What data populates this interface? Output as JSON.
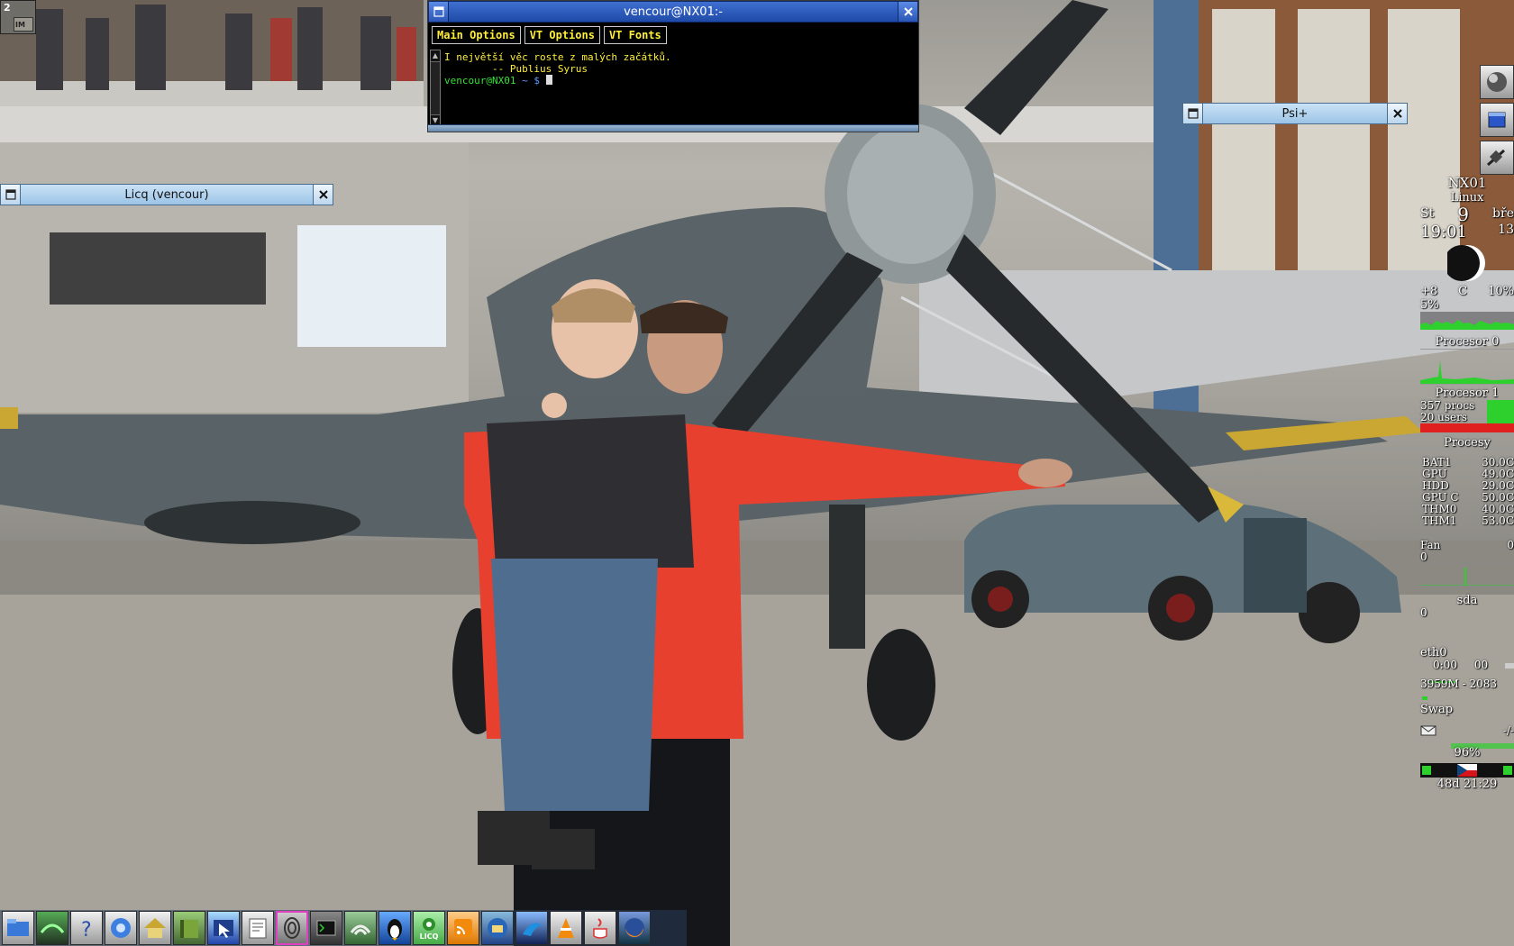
{
  "pager": {
    "desktop_number": "2",
    "mini_label": "IM"
  },
  "terminal": {
    "title": "vencour@NX01:-",
    "menus": [
      "Main Options",
      "VT Options",
      "VT Fonts"
    ],
    "lines": [
      "I největší věc roste z malých začátků.",
      "        -- Publius Syrus"
    ],
    "prompt_user": "vencour@NX01",
    "prompt_path": " ~ $ "
  },
  "licq_window": {
    "title": "Licq (vencour)"
  },
  "psi_window": {
    "title": "Psi+"
  },
  "monitor": {
    "host": "NX01",
    "os": "Linux",
    "day": "St",
    "date_num": "9",
    "month": "bře",
    "time": "19:01",
    "seconds": "13",
    "cpu_temp": "+8",
    "temp_unit": "C",
    "cpu_load": "10%",
    "cpu0_pct": "5%",
    "cpu0_label": "Procesor 0",
    "cpu1_label": "Procesor 1",
    "procs": "357 procs",
    "users": "20 users",
    "procs_label": "Procesy",
    "sensors": [
      {
        "name": "BAT1",
        "value": "30.0C"
      },
      {
        "name": "GPU",
        "value": "49.0C"
      },
      {
        "name": "HDD",
        "value": "29.0C"
      },
      {
        "name": "GPU C",
        "value": "50.0C"
      },
      {
        "name": "THM0",
        "value": "40.0C"
      },
      {
        "name": "THM1",
        "value": "53.0C"
      }
    ],
    "fan_label": "Fan",
    "fan_value": "0",
    "fan_graph_value": "0",
    "disk_label": "sda",
    "disk_value": "0",
    "net_label": "eth0",
    "net_time": "0:00",
    "net_extra": "00",
    "net_totals": "3959M - 2083",
    "swap_label": "Swap",
    "mail_value": "-/-",
    "battery_pct": "96%",
    "uptime": "48d 21:29"
  },
  "taskbar": {
    "apps": [
      "file-manager-icon",
      "nvidia-settings-icon",
      "help-icon",
      "browser-globe-icon",
      "home-folder-icon",
      "book-icon",
      "screenshot-icon",
      "text-editor-icon",
      "fingerprint-icon",
      "terminal-icon",
      "network-icon",
      "tux-icon",
      "licq-icon",
      "rss-reader-icon",
      "thunderbird-icon",
      "seamonkey-icon",
      "vlc-icon",
      "java-icon",
      "firefox-icon"
    ],
    "licq_label": "LICQ"
  },
  "colors": {
    "terminal_text": "#ffef3a",
    "prompt_green": "#38e038",
    "titlebar_active": "#1f4aa8",
    "titlebar_inactive": "#9cc4e6"
  }
}
